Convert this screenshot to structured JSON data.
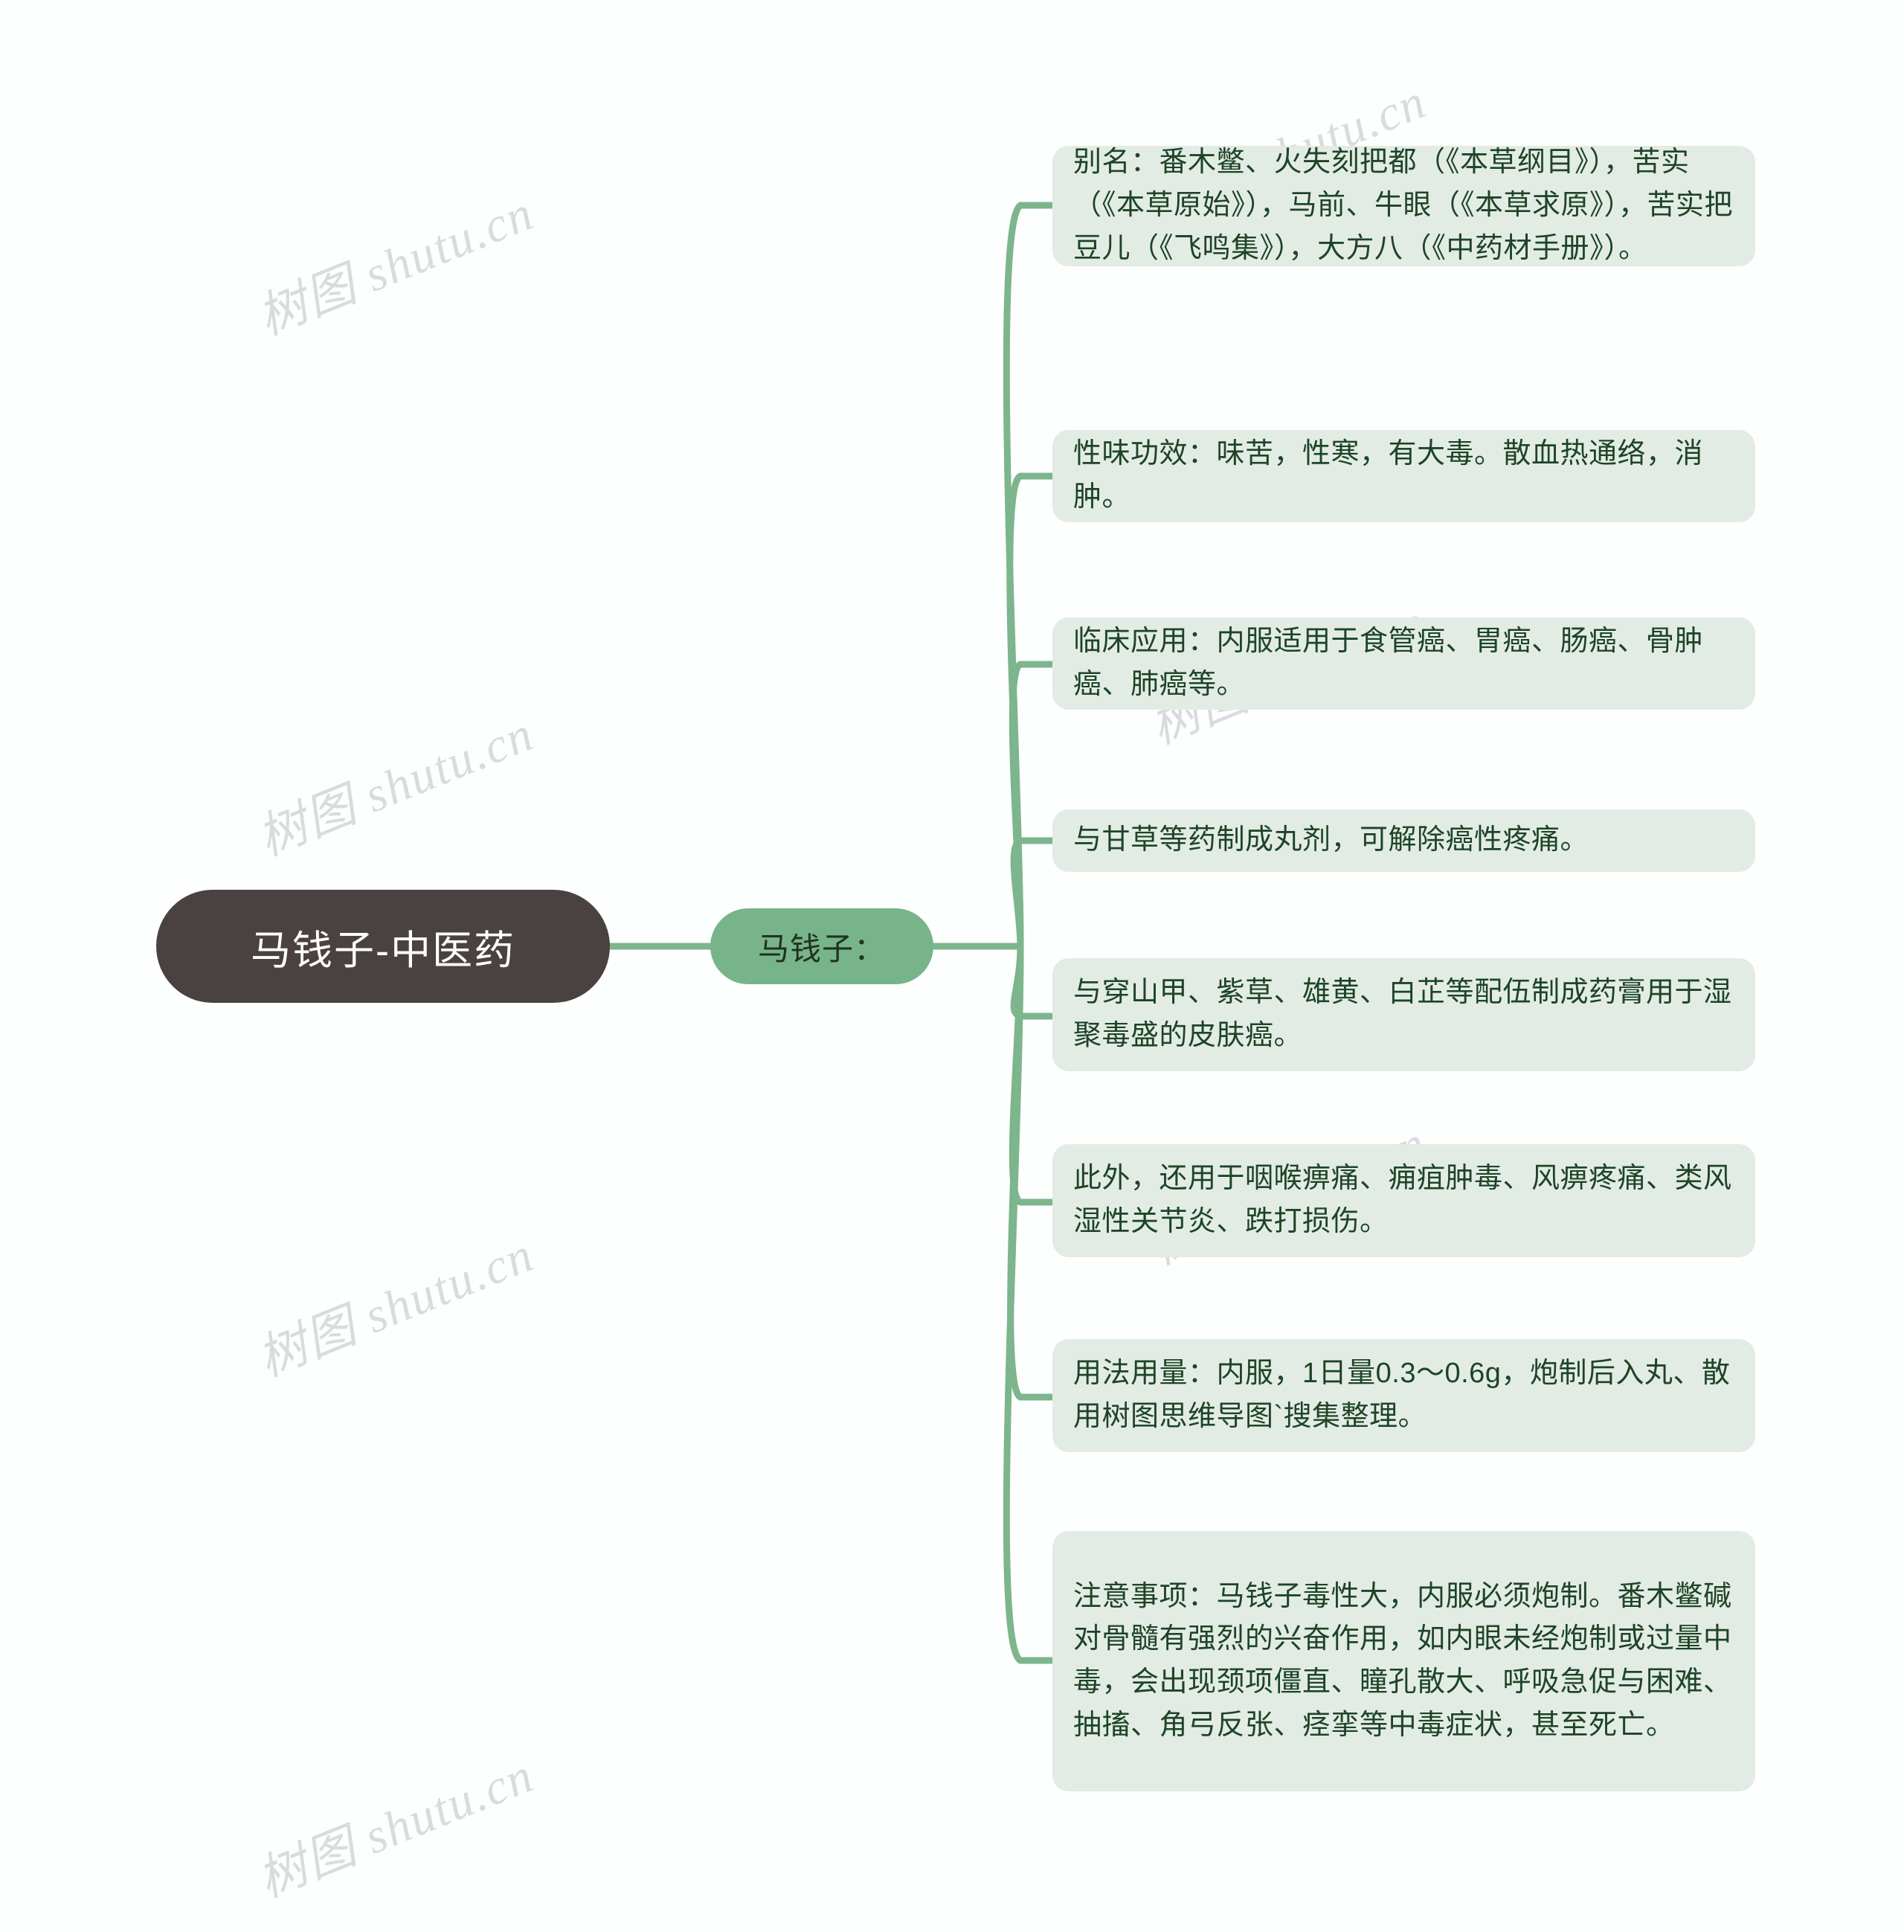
{
  "page": {
    "background_color": "#fdfefe",
    "watermark_text": "树图 shutu.cn",
    "watermark_color": "#d8dbdc"
  },
  "colors": {
    "root_fill": "#4a4240",
    "root_text": "#ffffff",
    "branch_fill": "#77b489",
    "branch_text": "#20331f",
    "leaf_fill": "#e3ece4",
    "leaf_text": "#1d4428",
    "connector": "#7db58c"
  },
  "mindmap": {
    "root": {
      "label": "马钱子-中医药"
    },
    "branch": {
      "label": "马钱子："
    },
    "leaves": [
      {
        "name": "alias",
        "text": "别名：番木鳖、火失刻把都（《本草纲目》），苦实（《本草原始》），马前、牛眼（《本草求原》），苦实把豆儿（《飞鸣集》），大方八（《中药材手册》）。"
      },
      {
        "name": "nature-flavor-efficacy",
        "text": "性味功效：味苦，性寒，有大毒。散血热通络，消肿。"
      },
      {
        "name": "clinical-application",
        "text": "临床应用：内服适用于食管癌、胃癌、肠癌、骨肿癌、肺癌等。"
      },
      {
        "name": "licorice-pill",
        "text": "与甘草等药制成丸剂，可解除癌性疼痛。"
      },
      {
        "name": "ointment-combination",
        "text": "与穿山甲、紫草、雄黄、白芷等配伍制成药膏用于湿聚毒盛的皮肤癌。"
      },
      {
        "name": "other-uses",
        "text": "此外，还用于咽喉痹痛、痈疽肿毒、风痹疼痛、类风湿性关节炎、跌打损伤。"
      },
      {
        "name": "dosage",
        "text": "用法用量：内服，1日量0.3～0.6g，炮制后入丸、散用树图思维导图`搜集整理。"
      },
      {
        "name": "precautions",
        "text": "注意事项：马钱子毒性大，内服必须炮制。番木鳖碱对骨髓有强烈的兴奋作用，如内眼未经炮制或过量中毒，会出现颈项僵直、瞳孔散大、呼吸急促与困难、抽搐、角弓反张、痉挛等中毒症状，甚至死亡。"
      }
    ]
  }
}
